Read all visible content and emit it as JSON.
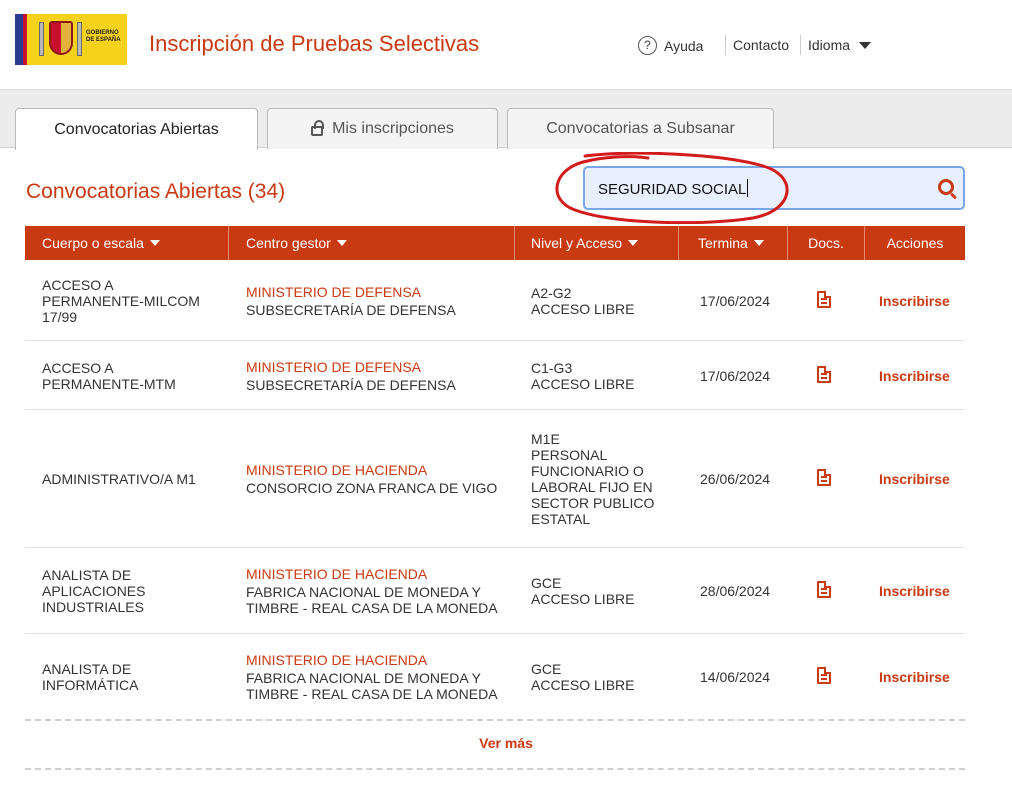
{
  "header": {
    "logo_text": "GOBIERNO DE ESPAÑA",
    "app_title": "Inscripción de Pruebas Selectivas",
    "help_label": "Ayuda",
    "contact_label": "Contacto",
    "language_label": "Idioma"
  },
  "tabs": [
    {
      "label": "Convocatorias Abiertas",
      "active": true
    },
    {
      "label": "Mis inscripciones",
      "active": false,
      "icon": "lock-icon"
    },
    {
      "label": "Convocatorias a Subsanar",
      "active": false
    }
  ],
  "main": {
    "section_title": "Convocatorias Abiertas (34)",
    "search": {
      "value": "SEGURIDAD SOCIAL",
      "icon": "search-icon"
    }
  },
  "table": {
    "headers": [
      "Cuerpo o escala",
      "Centro gestor",
      "Nivel y Acceso",
      "Termina",
      "Docs.",
      "Acciones"
    ],
    "rows": [
      {
        "cuerpo": [
          "ACCESO A",
          "PERMANENTE-MILCOM",
          "17/99"
        ],
        "ministerio": "MINISTERIO DE DEFENSA",
        "centro": [
          "SUBSECRETARÍA DE DEFENSA"
        ],
        "nivel": [
          "A2-G2",
          "ACCESO LIBRE"
        ],
        "termina": "17/06/2024",
        "accion": "Inscribirse"
      },
      {
        "cuerpo": [
          "ACCESO A",
          "PERMANENTE-MTM"
        ],
        "ministerio": "MINISTERIO DE DEFENSA",
        "centro": [
          "SUBSECRETARÍA DE DEFENSA"
        ],
        "nivel": [
          "C1-G3",
          "ACCESO LIBRE"
        ],
        "termina": "17/06/2024",
        "accion": "Inscribirse"
      },
      {
        "cuerpo": [
          "ADMINISTRATIVO/A M1"
        ],
        "ministerio": "MINISTERIO DE HACIENDA",
        "centro": [
          "CONSORCIO ZONA FRANCA DE VIGO"
        ],
        "nivel": [
          "M1E",
          "PERSONAL",
          "FUNCIONARIO O",
          "LABORAL FIJO EN",
          "SECTOR PUBLICO",
          "ESTATAL"
        ],
        "termina": "26/06/2024",
        "accion": "Inscribirse"
      },
      {
        "cuerpo": [
          "ANALISTA DE",
          "APLICACIONES",
          "INDUSTRIALES"
        ],
        "ministerio": "MINISTERIO DE HACIENDA",
        "centro": [
          "FABRICA NACIONAL DE MONEDA Y",
          "TIMBRE - REAL CASA DE LA MONEDA"
        ],
        "nivel": [
          "GCE",
          "ACCESO LIBRE"
        ],
        "termina": "28/06/2024",
        "accion": "Inscribirse"
      },
      {
        "cuerpo": [
          "ANALISTA DE",
          "INFORMÁTICA"
        ],
        "ministerio": "MINISTERIO DE HACIENDA",
        "centro": [
          "FABRICA NACIONAL DE MONEDA Y",
          "TIMBRE - REAL CASA DE LA MONEDA"
        ],
        "nivel": [
          "GCE",
          "ACCESO LIBRE"
        ],
        "termina": "14/06/2024",
        "accion": "Inscribirse"
      }
    ]
  },
  "footer": {
    "ver_mas": "Ver más"
  },
  "colors": {
    "accent": "#c83a12",
    "header_bg": "#c83a12",
    "search_border": "#79a6e6"
  }
}
